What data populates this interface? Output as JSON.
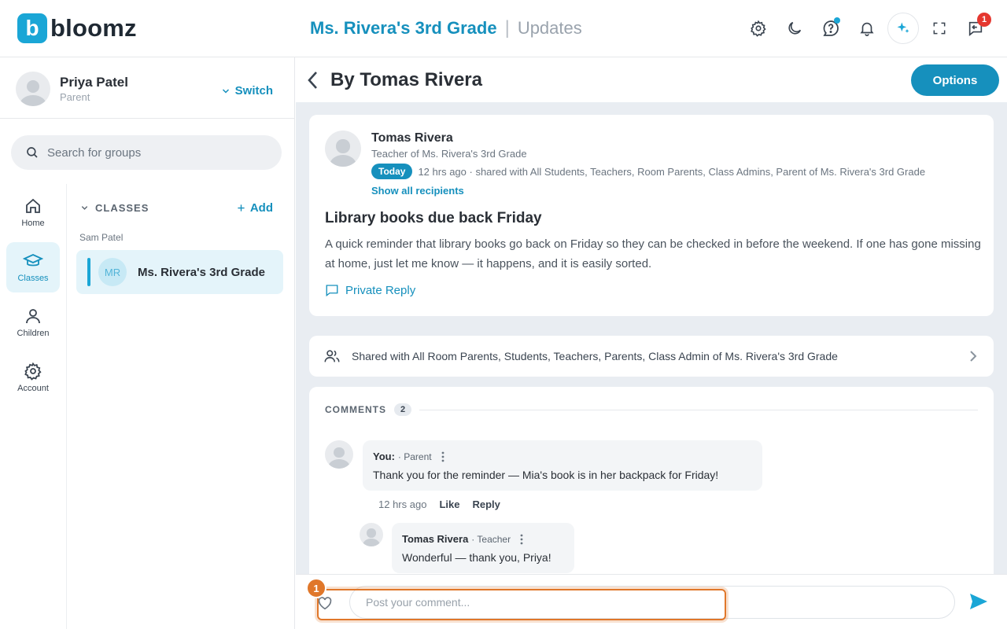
{
  "app": {
    "logo_letter": "b",
    "logo_text": "bloomz",
    "brand_color": "#1aa6d6"
  },
  "header": {
    "context": "Ms. Rivera's 3rd Grade",
    "separator": "|",
    "page": "Updates",
    "message_badge": "1"
  },
  "user": {
    "name": "Priya Patel",
    "role": "Parent",
    "switch_label": "Switch"
  },
  "search": {
    "placeholder": "Search for groups"
  },
  "rail": [
    {
      "label": "Home",
      "icon": "home-icon"
    },
    {
      "label": "Classes",
      "icon": "graduation-cap-icon"
    },
    {
      "label": "Children",
      "icon": "person-icon"
    },
    {
      "label": "Account",
      "icon": "gear-icon"
    }
  ],
  "classes": {
    "heading": "CLASSES",
    "add_label": "Add",
    "owner": "Sam Patel",
    "items": [
      {
        "initials": "MR",
        "name": "Ms. Rivera's 3rd Grade"
      }
    ]
  },
  "main": {
    "title": "By Tomas Rivera",
    "options_label": "Options"
  },
  "post": {
    "author": "Tomas Rivera",
    "author_role": "Teacher of Ms. Rivera's 3rd Grade",
    "tag": "Today",
    "meta": "12 hrs ago · shared with All Students, Teachers, Room Parents, Class Admins, Parent of Ms. Rivera's 3rd Grade",
    "show_all": "Show all recipients",
    "title": "Library books due back Friday",
    "body": "A quick reminder that library books go back on Friday so they can be checked in before the weekend. If one has gone missing at home, just let me know — it happens, and it is easily sorted.",
    "private_reply": "Private Reply"
  },
  "shared": {
    "text": "Shared with All Room Parents, Students, Teachers, Parents, Class Admin of Ms. Rivera's 3rd Grade"
  },
  "comments": {
    "heading": "COMMENTS",
    "count": "2",
    "items": [
      {
        "author": "You:",
        "role": "· Parent",
        "text": "Thank you for the reminder — Mia's book is in her backpack for Friday!",
        "time": "12 hrs ago",
        "like": "Like",
        "reply": "Reply"
      },
      {
        "author": "Tomas Rivera",
        "role": "· Teacher",
        "text": "Wonderful — thank you, Priya!"
      }
    ]
  },
  "composer": {
    "placeholder": "Post your comment...",
    "value": "",
    "highlight_number": "1"
  }
}
